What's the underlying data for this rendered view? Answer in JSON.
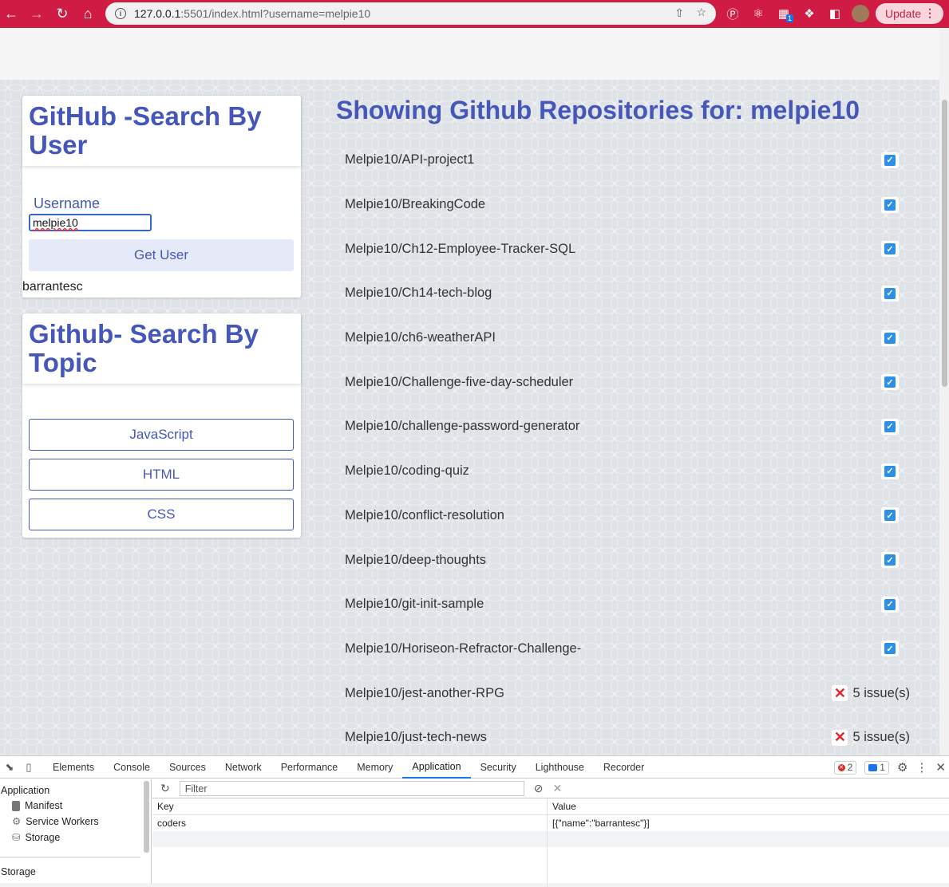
{
  "browser": {
    "url_host": "127.0.0.1",
    "url_rest": ":5501/index.html?username=melpie10",
    "update_label": "Update",
    "ext_badge": "1"
  },
  "user_card": {
    "title": "GitHub -Search By User",
    "username_label": "Username",
    "username_value": "melpie10",
    "button_label": "Get User",
    "saved_user": "barrantesc"
  },
  "topic_card": {
    "title": "Github- Search By Topic",
    "buttons": [
      "JavaScript",
      "HTML",
      "CSS"
    ]
  },
  "repos": {
    "title": "Showing Github Repositories for: melpie10",
    "items": [
      {
        "name": "Melpie10/API-project1",
        "status": "ok"
      },
      {
        "name": "Melpie10/BreakingCode",
        "status": "ok"
      },
      {
        "name": "Melpie10/Ch12-Employee-Tracker-SQL",
        "status": "ok"
      },
      {
        "name": "Melpie10/Ch14-tech-blog",
        "status": "ok"
      },
      {
        "name": "Melpie10/ch6-weatherAPI",
        "status": "ok"
      },
      {
        "name": "Melpie10/Challenge-five-day-scheduler",
        "status": "ok"
      },
      {
        "name": "Melpie10/challenge-password-generator",
        "status": "ok"
      },
      {
        "name": "Melpie10/coding-quiz",
        "status": "ok"
      },
      {
        "name": "Melpie10/conflict-resolution",
        "status": "ok"
      },
      {
        "name": "Melpie10/deep-thoughts",
        "status": "ok"
      },
      {
        "name": "Melpie10/git-init-sample",
        "status": "ok"
      },
      {
        "name": "Melpie10/Horiseon-Refractor-Challenge-",
        "status": "ok"
      },
      {
        "name": "Melpie10/jest-another-RPG",
        "status": "issues",
        "issues": "5 issue(s)"
      },
      {
        "name": "Melpie10/just-tech-news",
        "status": "issues",
        "issues": "5 issue(s)"
      }
    ]
  },
  "devtools": {
    "tabs": [
      "Elements",
      "Console",
      "Sources",
      "Network",
      "Performance",
      "Memory",
      "Application",
      "Security",
      "Lighthouse",
      "Recorder"
    ],
    "active_tab": "Application",
    "error_count": "2",
    "message_count": "1",
    "sidebar": {
      "section": "Application",
      "items": [
        "Manifest",
        "Service Workers",
        "Storage"
      ],
      "section2": "Storage"
    },
    "filter_placeholder": "Filter",
    "columns": {
      "key": "Key",
      "value": "Value"
    },
    "rows": [
      {
        "key": "coders",
        "value": "[{\"name\":\"barrantesc\"}]"
      }
    ]
  }
}
